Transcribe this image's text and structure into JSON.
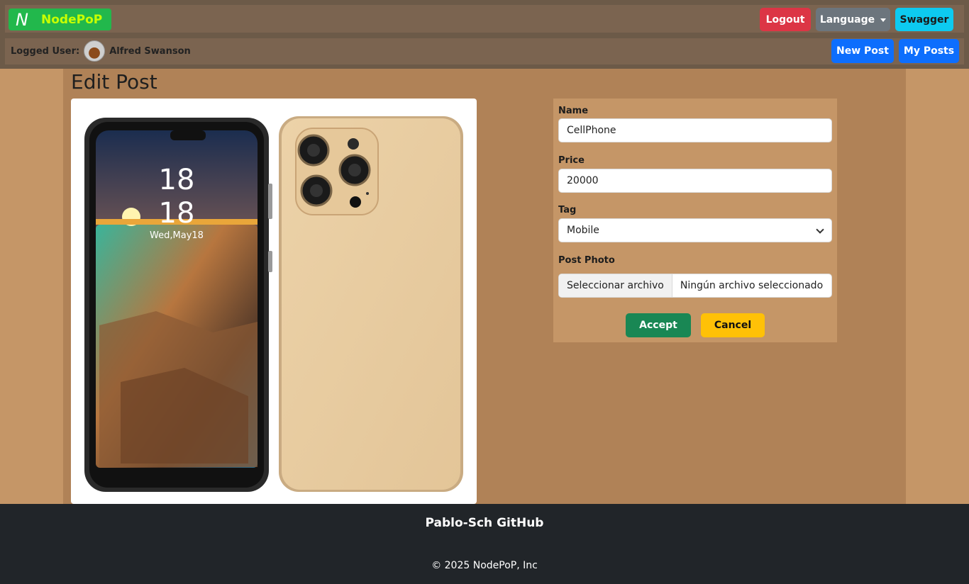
{
  "brand": {
    "logo_letter": "N",
    "name": "NodePoP"
  },
  "nav": {
    "logout": "Logout",
    "language": "Language",
    "swagger": "Swagger",
    "logged_label": "Logged User:",
    "user_name": "Alfred Swanson",
    "new_post": "New Post",
    "my_posts": "My Posts"
  },
  "page": {
    "title": "Edit Post"
  },
  "photo": {
    "time_hour": "18",
    "time_minute": "18",
    "date": "Wed,May18"
  },
  "form": {
    "name_label": "Name",
    "name_value": "CellPhone",
    "price_label": "Price",
    "price_value": "20000",
    "tag_label": "Tag",
    "tag_value": "Mobile",
    "photo_label": "Post Photo",
    "file_button": "Seleccionar archivo",
    "file_status": "Ningún archivo seleccionado",
    "accept": "Accept",
    "cancel": "Cancel"
  },
  "footer": {
    "link": "Pablo-Sch GitHub",
    "copyright": "© 2025 NodePoP, Inc"
  },
  "colors": {
    "page_bg": "#c59667",
    "container_bg": "#b08257",
    "navbar_bg": "#7b6450",
    "brand_bg": "#22b84c",
    "logout": "#dc3545",
    "language": "#6c757d",
    "swagger": "#0dcaf0",
    "primary": "#0d6efd",
    "accept": "#198754",
    "cancel": "#ffc107",
    "footer_bg": "#212529"
  }
}
